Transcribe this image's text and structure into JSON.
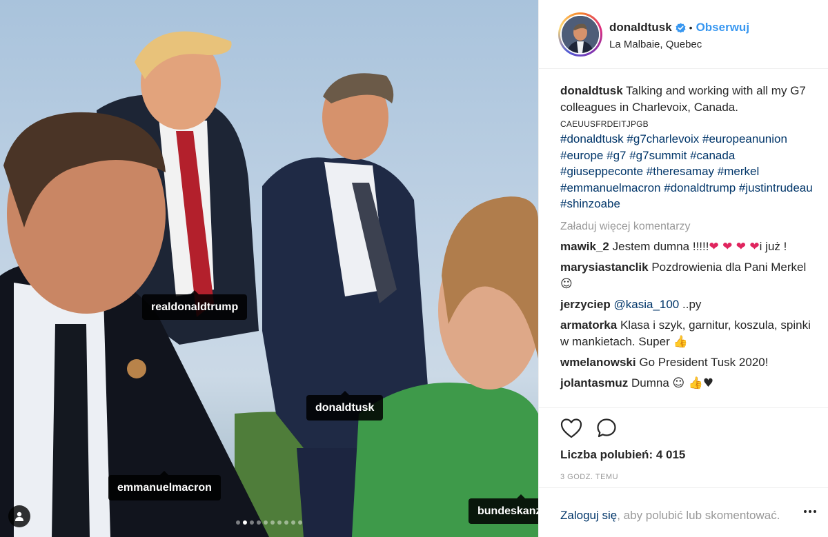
{
  "photo": {
    "tags": [
      {
        "name": "realdonaldtrump"
      },
      {
        "name": "donaldtusk"
      },
      {
        "name": "emmanuelmacron"
      },
      {
        "name": "bundeskanzlerin"
      }
    ],
    "carousel": {
      "count": 10,
      "active_index": 1
    }
  },
  "header": {
    "username": "donaldtusk",
    "bullet": "•",
    "follow_label": "Obserwuj",
    "location": "La Malbaie, Quebec"
  },
  "caption": {
    "username": "donaldtusk",
    "text": "Talking and working with all my G7 colleagues in Charlevoix, Canada.",
    "flags": "CAEUUSFRDEITJPGB",
    "hashtags": "#donaldtusk #g7charlevoix #europeanunion #europe #g7 #g7summit #canada #giuseppeconte #theresamay #merkel #emmanuelmacron #donaldtrump #justintrudeau #shinzoabe"
  },
  "load_more": "Załaduj więcej komentarzy",
  "comments": [
    {
      "user": "mawik_2",
      "text": "Jestem dumna !!!!!",
      "suffix_emoji": "❤ ❤ ❤ ❤",
      "tail": "i już !"
    },
    {
      "user": "marysiastanclik",
      "text": "Pozdrowienia dla Pani Merkel",
      "suffix_emoji": "☺"
    },
    {
      "user": "jerzyciep",
      "mention": "@kasia_100",
      "text": "..py"
    },
    {
      "user": "armatorka",
      "text": "Klasa i szyk, garnitur, koszula, spinki w mankietach. Super",
      "suffix_emoji": "👍"
    },
    {
      "user": "wmelanowski",
      "text": "Go President Tusk 2020!"
    },
    {
      "user": "jolantasmuz",
      "text": "Dumna",
      "suffix_emoji": "☺ 👍♥"
    }
  ],
  "likes": {
    "label": "Liczba polubień:",
    "count": "4 015"
  },
  "time": "3 GODZ. TEMU",
  "login": {
    "link": "Zaloguj się",
    "text": ", aby polubić lub skomentować."
  },
  "icons": {
    "like": "heart-outline-icon",
    "comment": "speech-bubble-icon",
    "verified": "verified-badge-icon",
    "more": "more-options-icon",
    "tagged_users": "user-tag-icon"
  },
  "colors": {
    "accent": "#3897f0",
    "link": "#003569",
    "muted": "#999999",
    "heart": "#e0245e"
  }
}
